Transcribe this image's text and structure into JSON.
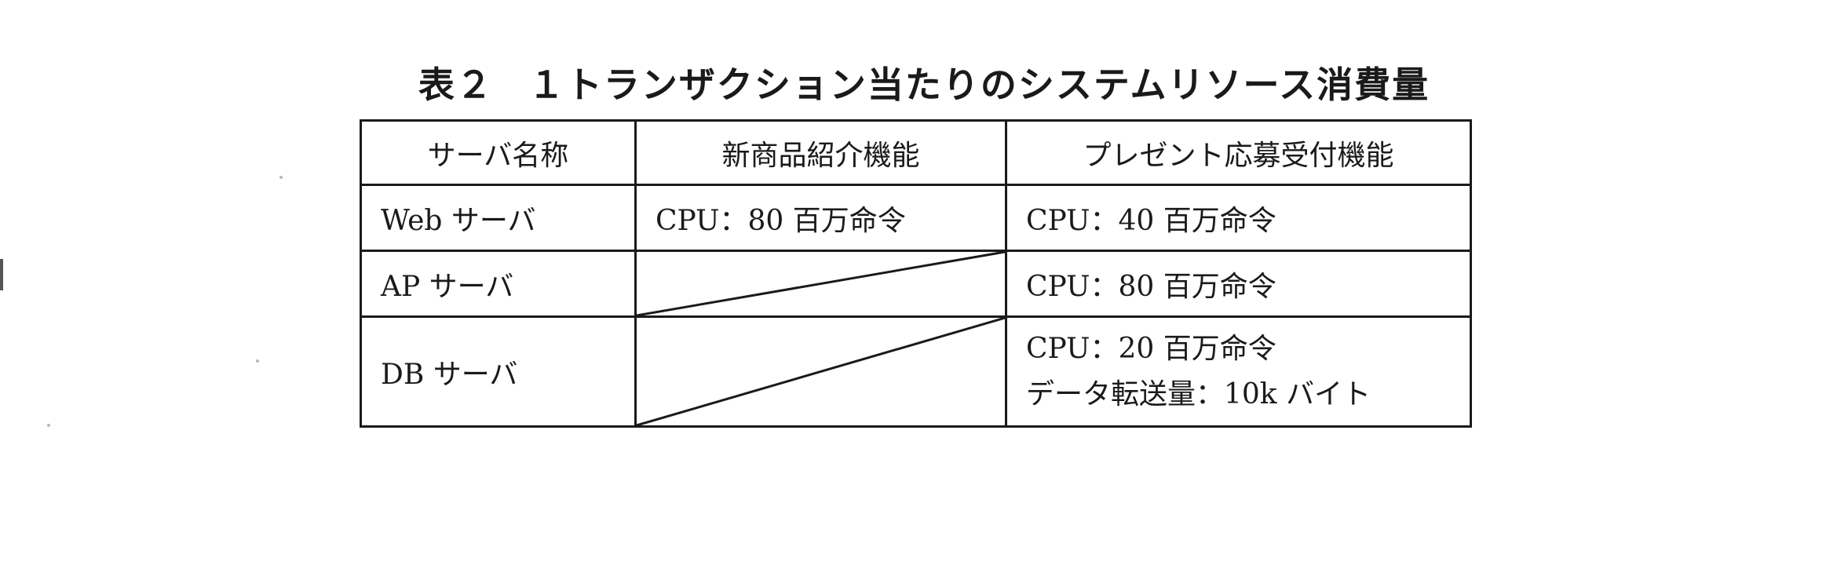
{
  "caption": {
    "label": "表２",
    "title": "１トランザクション当たりのシステムリソース消費量"
  },
  "table": {
    "headers": [
      "サーバ名称",
      "新商品紹介機能",
      "プレゼント応募受付機能"
    ],
    "rows": [
      {
        "server": "Web サーバ",
        "new_product": "CPU：80 百万命令",
        "present": [
          "CPU：40 百万命令"
        ]
      },
      {
        "server": "AP サーバ",
        "new_product": "",
        "present": [
          "CPU：80 百万命令"
        ]
      },
      {
        "server": "DB サーバ",
        "new_product": "",
        "present": [
          "CPU：20 百万命令",
          "データ転送量：10k バイト"
        ]
      }
    ]
  }
}
